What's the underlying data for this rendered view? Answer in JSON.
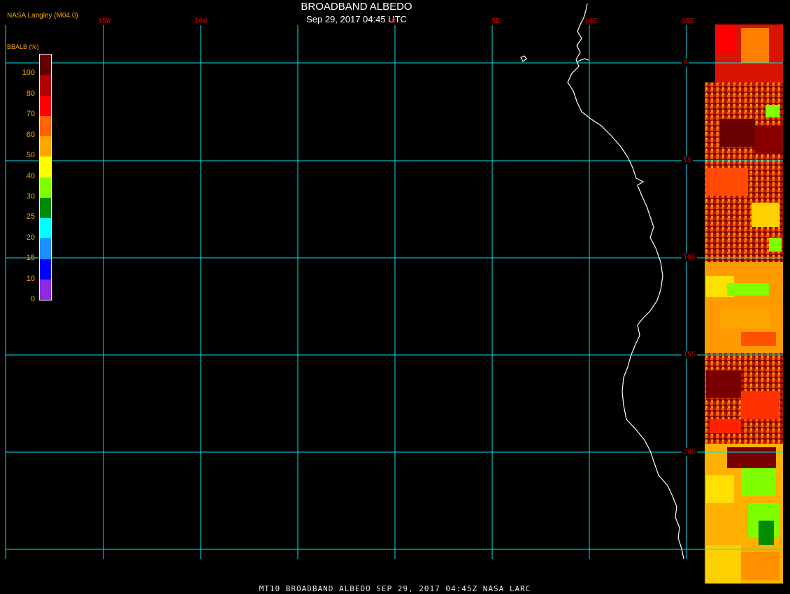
{
  "header": {
    "credit": "NASA Langley (M04.0)",
    "title": "BROADBAND ALBEDO",
    "subtitle": "Sep 29, 2017 04:45 UTC"
  },
  "footer": {
    "caption": "MT10  BROADBAND ALBEDO   SEP 29, 2017 04:45Z   NASA LARC"
  },
  "legend": {
    "title": "BBALB (%)",
    "ticks": [
      "0",
      "10",
      "15",
      "20",
      "25",
      "30",
      "40",
      "50",
      "60",
      "70",
      "80",
      "100"
    ],
    "colors": [
      "#8b2be2",
      "#0000ff",
      "#1e8fff",
      "#00ffff",
      "#008b00",
      "#7fff00",
      "#ffff00",
      "#ffa500",
      "#ff6400",
      "#ff0000",
      "#b40000",
      "#640000"
    ]
  },
  "grid": {
    "longitude_labels": [
      "15W",
      "10W",
      "0",
      "5E",
      "10E",
      "15E"
    ],
    "latitude_labels": [
      "0",
      "5S",
      "10S",
      "15S",
      "20S"
    ],
    "line_color": "#00e5ee"
  },
  "colors": {
    "background": "#000000",
    "coastline": "#ffffff",
    "label_red": "#d00000",
    "label_orange": "#f7a600"
  }
}
